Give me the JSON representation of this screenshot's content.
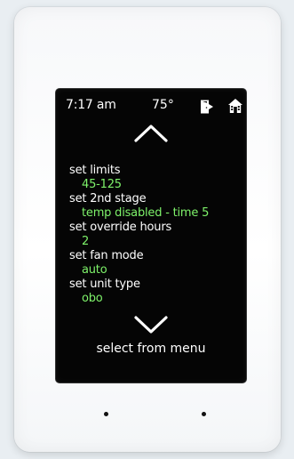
{
  "status_bar": {
    "time": "7:17 am",
    "temperature": "75°",
    "door_icon": "exit-door-icon",
    "home_icon": "home-icon"
  },
  "navigation": {
    "up_icon": "chevron-up-icon",
    "down_icon": "chevron-down-icon"
  },
  "menu": {
    "items": [
      {
        "label": "set limits",
        "value": "45-125"
      },
      {
        "label": "set 2nd stage",
        "value": "temp disabled - time 5"
      },
      {
        "label": "set override hours",
        "value": "2"
      },
      {
        "label": "set fan mode",
        "value": "auto"
      },
      {
        "label": "set unit type",
        "value": "obo"
      }
    ]
  },
  "footer": {
    "instruction": "select from menu"
  },
  "colors": {
    "screen_background": "#050505",
    "label_text": "#ffffff",
    "value_text": "#7ef26a",
    "device_frame": "#f7f8fa"
  }
}
